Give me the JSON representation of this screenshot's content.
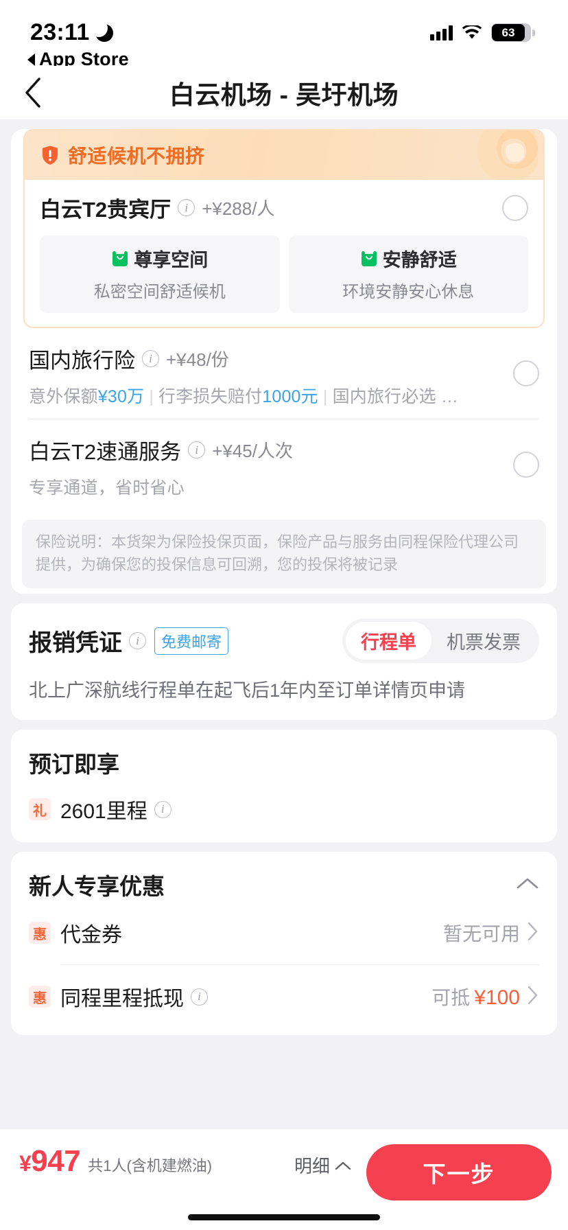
{
  "status_bar": {
    "time": "23:11",
    "moon_icon": "moon-icon",
    "back_app_label": "App Store",
    "signal_icon": "cellular-signal-icon",
    "wifi_icon": "wifi-icon",
    "battery_level": "63"
  },
  "nav": {
    "back_icon": "chevron-left-icon",
    "title": "白云机场 - 吴圩机场"
  },
  "ancillary": {
    "lounge": {
      "banner_text": "舒适候机不拥挤",
      "banner_icon": "exclamation-shield-icon",
      "name": "白云T2贵宾厅",
      "info_icon": "info-icon",
      "price": "+¥288/人",
      "radio_icon": "radio-unchecked-icon",
      "features": [
        {
          "icon": "armchair-icon",
          "title": "尊享空间",
          "desc": "私密空间舒适候机"
        },
        {
          "icon": "armchair-icon",
          "title": "安静舒适",
          "desc": "环境安静安心休息"
        }
      ]
    },
    "items": [
      {
        "name": "国内旅行险",
        "info_icon": "info-icon",
        "price": "+¥48/份",
        "desc_parts": [
          {
            "text": "意外保额",
            "style": "muted"
          },
          {
            "text": "¥30万",
            "style": "highlight"
          },
          {
            "text": "|",
            "style": "sep"
          },
          {
            "text": "行李损失赔付",
            "style": "muted"
          },
          {
            "text": "1000元",
            "style": "highlight"
          },
          {
            "text": "|",
            "style": "sep"
          },
          {
            "text": "国内旅行必选 …",
            "style": "muted"
          }
        ],
        "radio_icon": "radio-unchecked-icon"
      },
      {
        "name": "白云T2速通服务",
        "info_icon": "info-icon",
        "price": "+¥45/人次",
        "desc": "专享通道，省时省心",
        "radio_icon": "radio-unchecked-icon"
      }
    ],
    "disclaimer": "保险说明：本货架为保险投保页面，保险产品与服务由同程保险代理公司提供，为确保您的投保信息可回溯，您的投保将被记录"
  },
  "invoice": {
    "title": "报销凭证",
    "info_icon": "info-icon",
    "free_mail_badge": "免费邮寄",
    "tabs": [
      {
        "label": "行程单",
        "active": true
      },
      {
        "label": "机票发票",
        "active": false
      }
    ],
    "note": "北上广深航线行程单在起飞后1年内至订单详情页申请"
  },
  "reward": {
    "title": "预订即享",
    "badge": "礼",
    "text": "2601里程",
    "info_icon": "info-icon"
  },
  "promo": {
    "title": "新人专享优惠",
    "collapse_icon": "chevron-up-icon",
    "rows": [
      {
        "badge": "惠",
        "label": "代金券",
        "value": "暂无可用",
        "value_style": "muted",
        "has_info": false,
        "chevron_icon": "chevron-right-icon"
      },
      {
        "badge": "惠",
        "label": "同程里程抵现",
        "value_prefix": "可抵",
        "value": "¥100",
        "value_style": "red",
        "has_info": true,
        "info_icon": "info-icon",
        "chevron_icon": "chevron-right-icon"
      }
    ]
  },
  "bottom_bar": {
    "currency": "¥",
    "amount": "947",
    "sub_label": "共1人(含机建燃油)",
    "detail_label": "明细",
    "detail_icon": "chevron-up-icon",
    "next_button": "下一步"
  },
  "colors": {
    "accent_red": "#f5414f",
    "orange": "#ef6c24",
    "blue": "#3ba3e8",
    "green": "#07c160"
  }
}
